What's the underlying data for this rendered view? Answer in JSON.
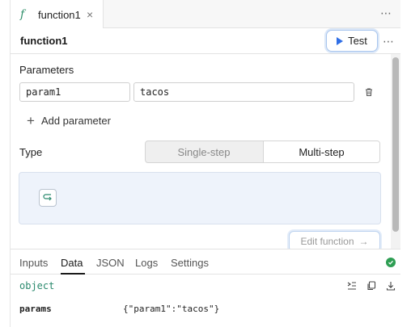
{
  "tab": {
    "icon": "function-icon",
    "icon_glyph": "f",
    "title": "function1",
    "close": "×"
  },
  "tabbar_menu": "⋯",
  "header": {
    "title": "function1",
    "test_label": "Test",
    "menu": "⋯"
  },
  "parameters": {
    "label": "Parameters",
    "rows": [
      {
        "key": "param1",
        "value": "tacos"
      }
    ],
    "add_label": "Add parameter",
    "add_glyph": "+"
  },
  "type": {
    "label": "Type",
    "options": [
      "Single-step",
      "Multi-step"
    ],
    "selected": "Multi-step"
  },
  "edit_function_label": "Edit function",
  "edit_function_arrow": "→",
  "bottom_tabs": [
    "Inputs",
    "Data",
    "JSON",
    "Logs",
    "Settings"
  ],
  "bottom_active_tab": "Data",
  "data_panel": {
    "type_label": "object",
    "properties": [
      {
        "key": "params",
        "value": "{\"param1\":\"tacos\"}"
      }
    ]
  },
  "colors": {
    "accent_blue": "#2f6ee6",
    "success_green": "#2e9e53",
    "type_green": "#2b8a6e"
  }
}
